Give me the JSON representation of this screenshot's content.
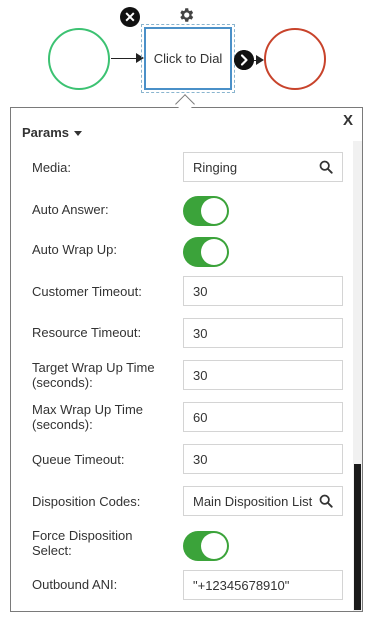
{
  "diagram": {
    "task_label": "Click to Dial",
    "delete_icon": "close-circle-icon",
    "settings_icon": "gear-icon",
    "next_icon": "chevron-right-circle-icon",
    "colors": {
      "start": "#3cc272",
      "end": "#c8432b",
      "task_border": "#4a90c8"
    }
  },
  "panel": {
    "close_label": "X",
    "section_title": "Params",
    "fields": {
      "media": {
        "label": "Media:",
        "value": "Ringing"
      },
      "auto_answer": {
        "label": "Auto Answer:",
        "on": true
      },
      "auto_wrap_up": {
        "label": "Auto Wrap Up:",
        "on": true
      },
      "customer_timeout": {
        "label": "Customer Timeout:",
        "value": "30"
      },
      "resource_timeout": {
        "label": "Resource Timeout:",
        "value": "30"
      },
      "target_wrap_up": {
        "label_line1": "Target Wrap Up Time",
        "label_line2": "(seconds):",
        "value": "30"
      },
      "max_wrap_up": {
        "label_line1": "Max Wrap Up Time",
        "label_line2": "(seconds):",
        "value": "60"
      },
      "queue_timeout": {
        "label": "Queue Timeout:",
        "value": "30"
      },
      "disposition_codes": {
        "label": "Disposition Codes:",
        "value": "Main Disposition List"
      },
      "force_disposition": {
        "label_line1": "Force Disposition",
        "label_line2": "Select:",
        "on": true
      },
      "outbound_ani": {
        "label": "Outbound ANI:",
        "value": "\"+12345678910\""
      }
    },
    "toggle_color": "#3ba33a"
  }
}
